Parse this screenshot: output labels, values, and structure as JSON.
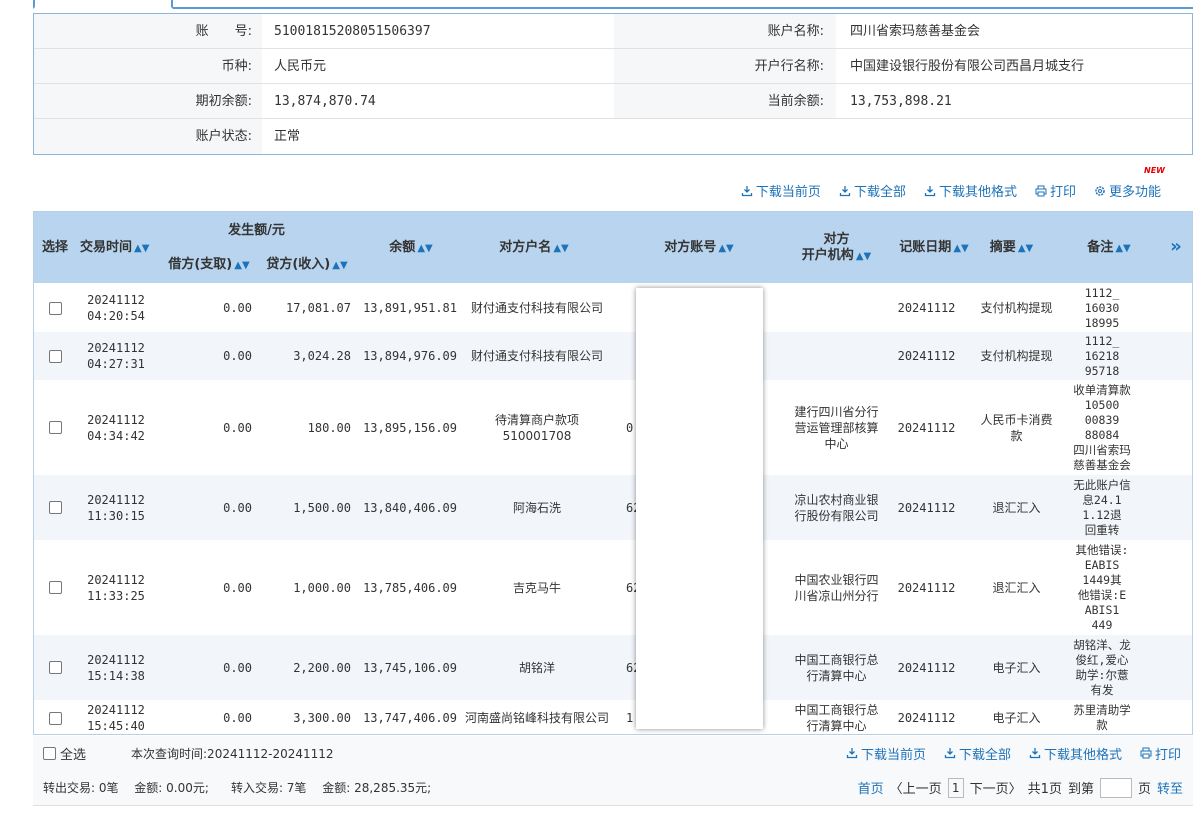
{
  "account": {
    "number_label": "账　　号:",
    "number": "51001815208051506397",
    "name_label": "账户名称:",
    "name": "四川省索玛慈善基金会",
    "currency_label": "币种:",
    "currency": "人民币元",
    "bank_label": "开户行名称:",
    "bank": "中国建设银行股份有限公司西昌月城支行",
    "opening_balance_label": "期初余额:",
    "opening_balance": "13,874,870.74",
    "current_balance_label": "当前余额:",
    "current_balance": "13,753,898.21",
    "status_label": "账户状态:",
    "status": "正常"
  },
  "badge_new": "NEW",
  "toolbar": {
    "download_page": "下载当前页",
    "download_all": "下载全部",
    "download_other": "下载其他格式",
    "print": "打印",
    "more": "更多功能"
  },
  "table": {
    "headers": {
      "select": "选择",
      "time": "交易时间",
      "amount_group": "发生额/元",
      "debit": "借方(支取)",
      "credit": "贷方(收入)",
      "balance": "余额",
      "counterparty_name": "对方户名",
      "counterparty_account": "对方账号",
      "counterparty_bank_1": "对方",
      "counterparty_bank_2": "开户机构",
      "post_date": "记账日期",
      "summary": "摘要",
      "remark": "备注",
      "more": "»"
    },
    "rows": [
      {
        "time1": "20241112",
        "time2": "04:20:54",
        "debit": "0.00",
        "credit": "17,081.07",
        "balance": "13,891,951.81",
        "name": "财付通支付科技有限公司",
        "acct": "",
        "bank": "",
        "date": "20241112",
        "summary": "支付机构提现",
        "remark": "1112_\n16030\n18995"
      },
      {
        "time1": "20241112",
        "time2": "04:27:31",
        "debit": "0.00",
        "credit": "3,024.28",
        "balance": "13,894,976.09",
        "name": "财付通支付科技有限公司",
        "acct": "",
        "bank": "",
        "date": "20241112",
        "summary": "支付机构提现",
        "remark": "1112_\n16218\n95718"
      },
      {
        "time1": "20241112",
        "time2": "04:34:42",
        "debit": "0.00",
        "credit": "180.00",
        "balance": "13,895,156.09",
        "name": "待清算商户款项510001708",
        "acct": "0",
        "bank": "建行四川省分行营运管理部核算中心",
        "date": "20241112",
        "summary": "人民币卡消费款",
        "remark": "收单清算款\n10500\n00839\n88084\n四川省索玛\n慈善基金会"
      },
      {
        "time1": "20241112",
        "time2": "11:30:15",
        "debit": "0.00",
        "credit": "1,500.00",
        "balance": "13,840,406.09",
        "name": "阿海石洗",
        "acct": "62",
        "bank": "凉山农村商业银行股份有限公司",
        "date": "20241112",
        "summary": "退汇汇入",
        "remark": "无此账户信\n息24.1\n1.12退\n回重转"
      },
      {
        "time1": "20241112",
        "time2": "11:33:25",
        "debit": "0.00",
        "credit": "1,000.00",
        "balance": "13,785,406.09",
        "name": "吉克马牛",
        "acct": "62",
        "bank": "中国农业银行四川省凉山州分行",
        "date": "20241112",
        "summary": "退汇汇入",
        "remark": "其他错误:\nEABIS\n1449其\n他错误:E\nABIS1\n449"
      },
      {
        "time1": "20241112",
        "time2": "15:14:38",
        "debit": "0.00",
        "credit": "2,200.00",
        "balance": "13,745,106.09",
        "name": "胡铭洋",
        "acct": "62",
        "bank": "中国工商银行总行清算中心",
        "date": "20241112",
        "summary": "电子汇入",
        "remark": "胡铭洋、龙\n俊红,爱心\n助学:尔薏\n有发"
      },
      {
        "time1": "20241112",
        "time2": "15:45:40",
        "debit": "0.00",
        "credit": "3,300.00",
        "balance": "13,747,406.09",
        "name": "河南盛尚铭峰科技有限公司",
        "acct": "1",
        "bank": "中国工商银行总行清算中心",
        "date": "20241112",
        "summary": "电子汇入",
        "remark": "苏里清助学\n款"
      }
    ]
  },
  "footer": {
    "select_all": "全选",
    "query_time": "本次查询时间:20241112-20241112",
    "download_page": "下载当前页",
    "download_all": "下载全部",
    "download_other": "下载其他格式",
    "print": "打印",
    "summary_out": "转出交易: 0笔　 金额: 0.00元;",
    "summary_in": "转入交易: 7笔　 金额: 28,285.35元;",
    "first": "首页",
    "prev": "〈上一页",
    "page": "1",
    "next": "下一页〉",
    "total": "共1页",
    "goto": "到第",
    "page_unit": "页",
    "go": "转至"
  }
}
